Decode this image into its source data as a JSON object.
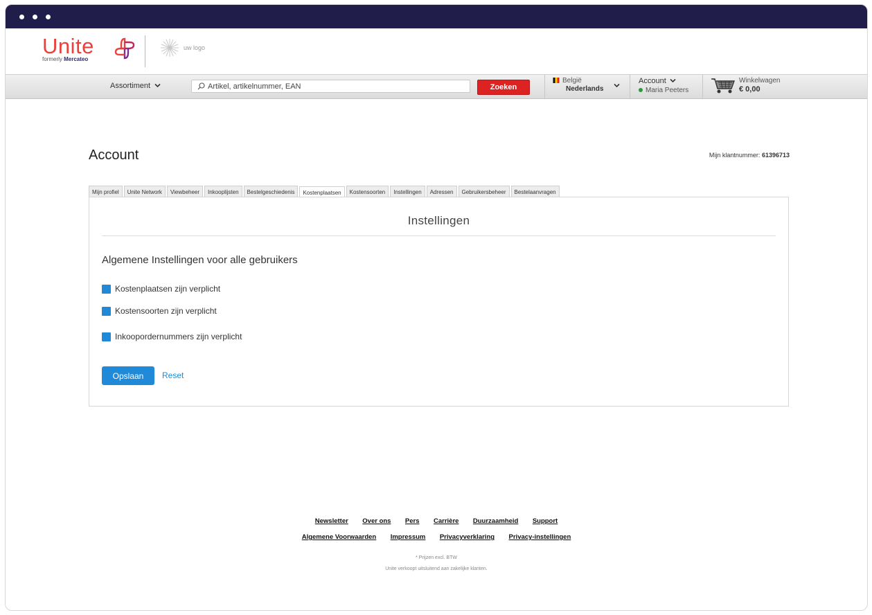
{
  "brand": {
    "name": "Unite",
    "formerly": "formerly",
    "formerly_brand": "Mercateo",
    "partner_logo": "uw logo"
  },
  "nav": {
    "assortment": "Assortiment",
    "search_placeholder": "Artikel, artikelnummer, EAN",
    "search_button": "Zoeken",
    "country": "België",
    "language": "Nederlands",
    "account_label": "Account",
    "user_name": "Maria Peeters",
    "cart_label": "Winkelwagen",
    "cart_total": "€ 0,00"
  },
  "page": {
    "title": "Account",
    "customer_label": "Mijn klantnummer:",
    "customer_number": "61396713"
  },
  "tabs": [
    "Mijn profiel",
    "Unite Network",
    "Viewbeheer",
    "Inkooplijsten",
    "Bestelgeschiedenis",
    "Kostenplaatsen",
    "Kostensoorten",
    "Instellingen",
    "Adressen",
    "Gebruikersbeheer",
    "Bestelaanvragen"
  ],
  "active_tab": "Kostenplaatsen",
  "panel": {
    "title": "Instellingen",
    "section_title": "Algemene Instellingen voor alle gebruikers",
    "options": [
      {
        "label": "Kostenplaatsen zijn verplicht",
        "checked": true
      },
      {
        "label": "Kostensoorten zijn verplicht",
        "checked": true
      },
      {
        "label": "Inkoopordernummers zijn verplicht",
        "checked": true
      }
    ],
    "save_label": "Opslaan",
    "reset_label": "Reset"
  },
  "footer": {
    "links_row1": [
      "Newsletter",
      "Over ons",
      "Pers",
      "Carrière",
      "Duurzaamheid",
      "Support"
    ],
    "links_row2": [
      "Algemene Voorwaarden",
      "Impressum",
      "Privacyverklaring",
      "Privacy-instellingen"
    ],
    "note1": "* Prijzen excl. BTW",
    "note2": "Unite verkoopt uitsluitend aan zakelijke klanten."
  },
  "colors": {
    "titlebar": "#211d4a",
    "brand_red": "#e8423f",
    "search_button": "#dd2222",
    "accent_blue": "#2089d8"
  },
  "icons": [
    "search-icon",
    "chevron-down-icon",
    "belgium-flag-icon",
    "cart-icon",
    "brand-cross-icon"
  ]
}
